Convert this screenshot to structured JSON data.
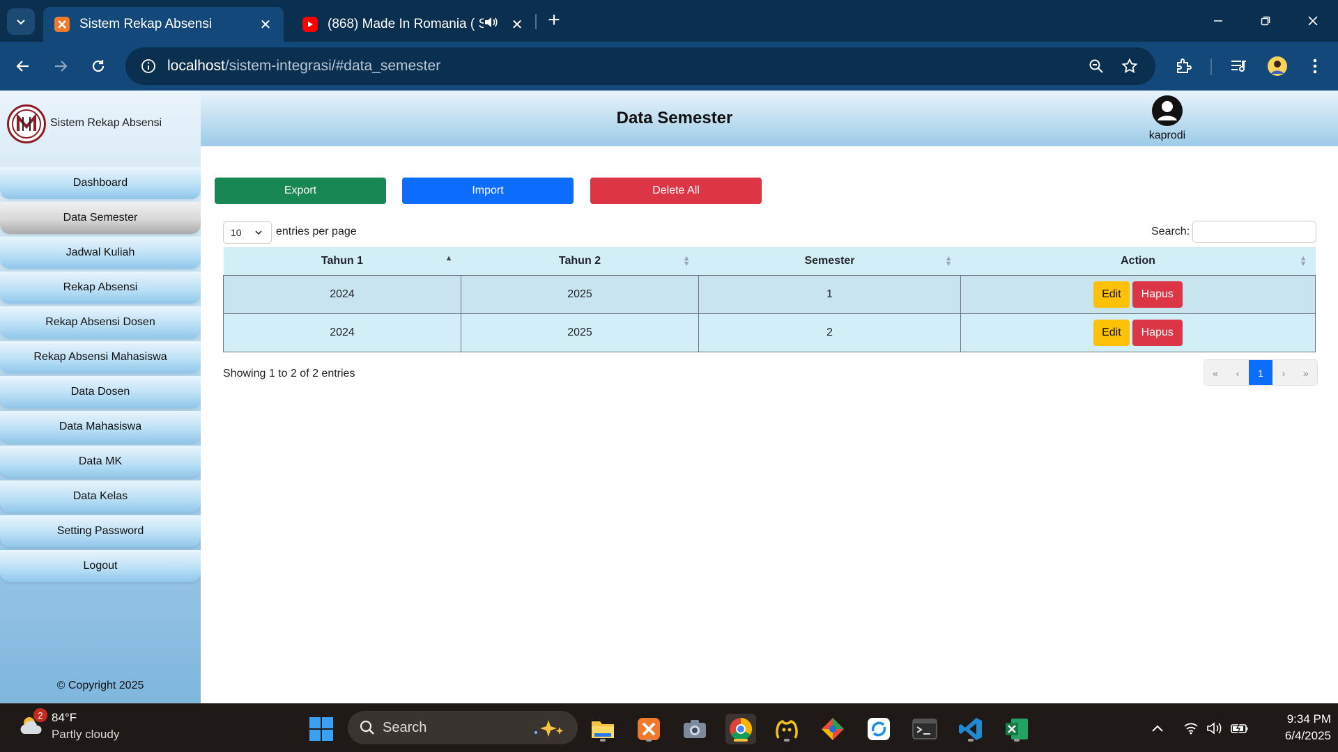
{
  "browser": {
    "tabs": [
      {
        "title": "Sistem Rekap Absensi",
        "active": true
      },
      {
        "title": "(868) Made In Romania ( Sl",
        "active": false
      }
    ],
    "url_host": "localhost",
    "url_path": "/sistem-integrasi/#data_semester"
  },
  "app": {
    "brand": "Sistem Rekap Absensi",
    "page_title": "Data Semester",
    "user": "kaprodi",
    "copyright": "© Copyright 2025"
  },
  "sidebar": {
    "items": [
      {
        "label": "Dashboard",
        "active": false
      },
      {
        "label": "Data Semester",
        "active": true
      },
      {
        "label": "Jadwal Kuliah",
        "active": false
      },
      {
        "label": "Rekap Absensi",
        "active": false
      },
      {
        "label": "Rekap Absensi Dosen",
        "active": false
      },
      {
        "label": "Rekap Absensi Mahasiswa",
        "active": false
      },
      {
        "label": "Data Dosen",
        "active": false
      },
      {
        "label": "Data Mahasiswa",
        "active": false
      },
      {
        "label": "Data MK",
        "active": false
      },
      {
        "label": "Data Kelas",
        "active": false
      },
      {
        "label": "Setting Password",
        "active": false
      },
      {
        "label": "Logout",
        "active": false
      }
    ]
  },
  "actions": {
    "export": "Export",
    "import": "Import",
    "delete_all": "Delete All"
  },
  "datatable": {
    "page_length": "10",
    "length_label": "entries per page",
    "search_label": "Search:",
    "search_value": "",
    "columns": [
      "Tahun 1",
      "Tahun 2",
      "Semester",
      "Action"
    ],
    "rows": [
      {
        "tahun1": "2024",
        "tahun2": "2025",
        "semester": "1"
      },
      {
        "tahun1": "2024",
        "tahun2": "2025",
        "semester": "2"
      }
    ],
    "edit_label": "Edit",
    "delete_label": "Hapus",
    "info": "Showing 1 to 2 of 2 entries",
    "pagination": {
      "first": "«",
      "prev": "‹",
      "current": "1",
      "next": "›",
      "last": "»"
    }
  },
  "taskbar": {
    "weather_temp": "84°F",
    "weather_cond": "Partly cloudy",
    "weather_badge": "2",
    "search_label": "Search",
    "time": "9:34 PM",
    "date": "6/4/2025"
  },
  "colors": {
    "export": "#198754",
    "import": "#0d6efd",
    "delete": "#dc3545",
    "edit": "#ffc107",
    "browser_bg": "#0b2f4f",
    "toolbar_bg": "#12497a"
  }
}
